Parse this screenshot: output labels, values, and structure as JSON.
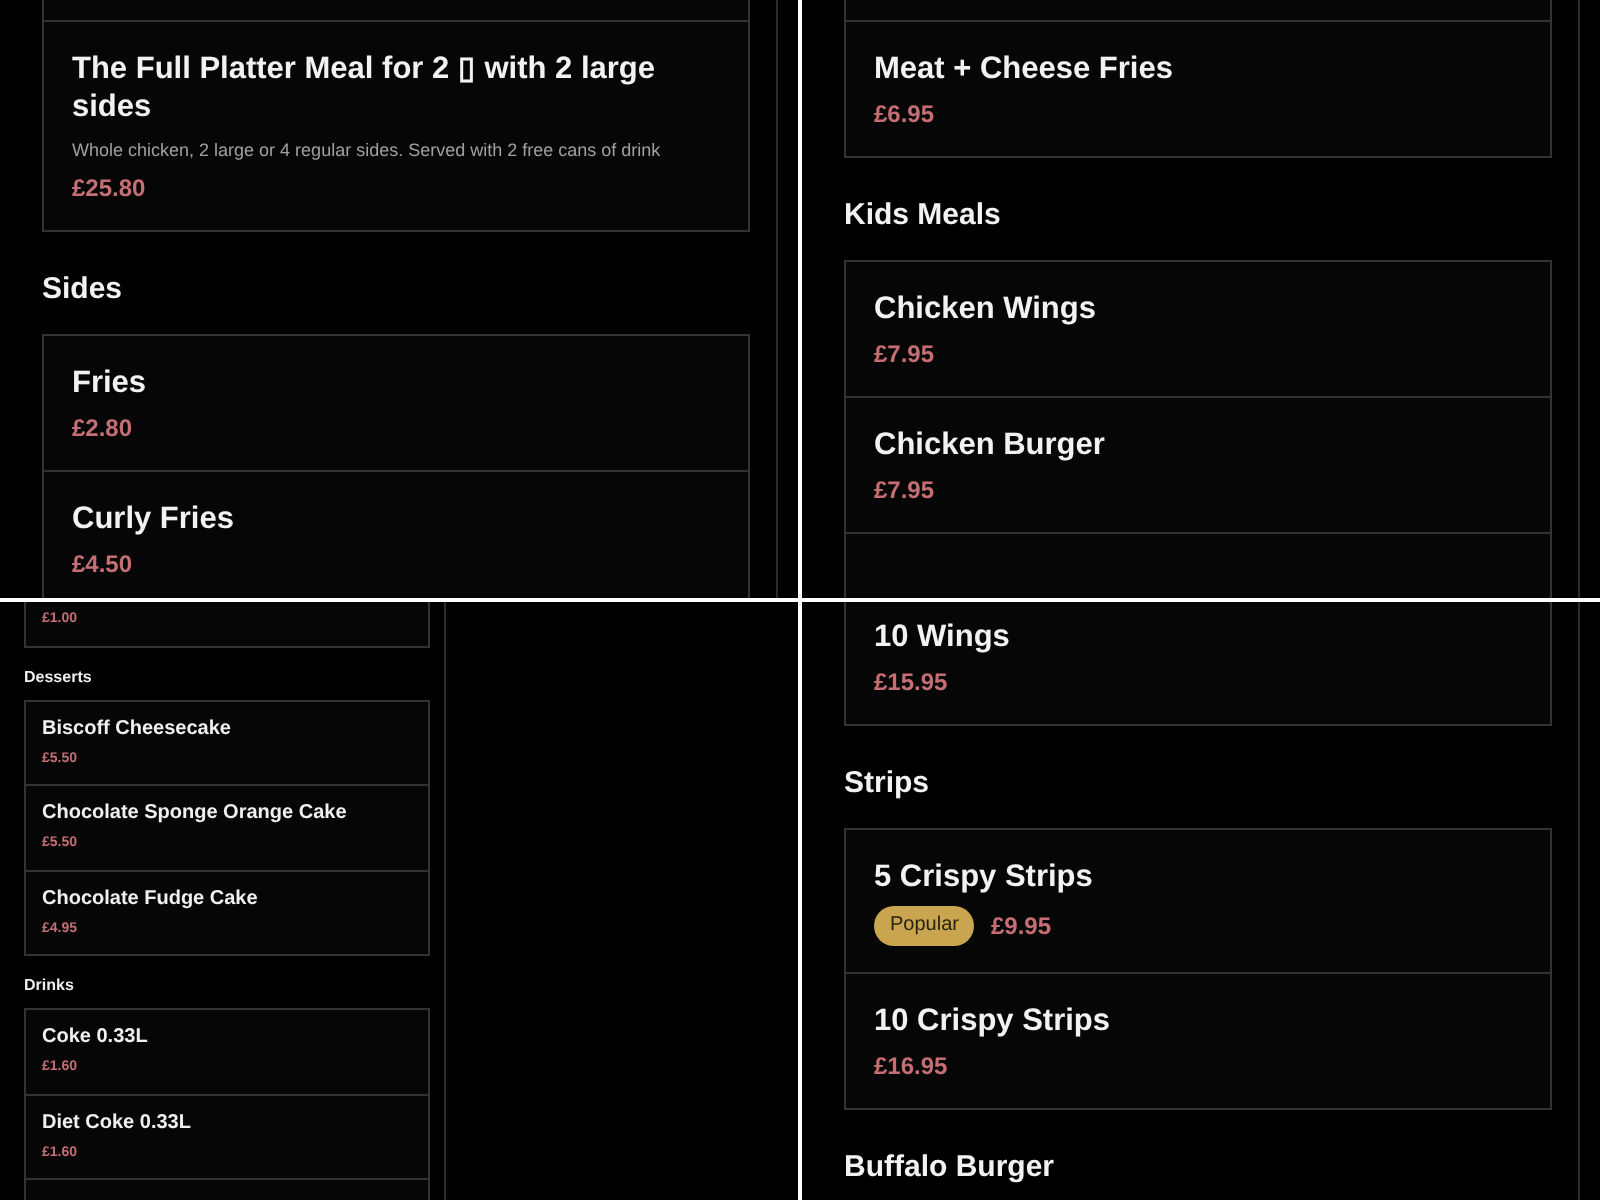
{
  "panels": [
    {
      "kind": "mobile",
      "sections": [
        {
          "continues_from_above": true,
          "items": [
            {
              "name": "The Full Platter Meal for 2 ▯ with 2 large sides",
              "description": "Whole chicken, 2 large or 4 regular sides. Served with 2 free cans of drink",
              "price": "£25.80"
            }
          ]
        },
        {
          "heading": "Sides",
          "items": [
            {
              "name": "Fries",
              "price": "£2.80"
            },
            {
              "name": "Curly Fries",
              "price": "£4.50"
            }
          ]
        }
      ]
    },
    {
      "kind": "mobile",
      "sections": [
        {
          "continues_from_above": true,
          "items": [
            {
              "name": "Meat + Cheese Fries",
              "price": "£6.95"
            }
          ]
        },
        {
          "heading": "Kids Meals",
          "continues_below": true,
          "items": [
            {
              "name": "Chicken Wings",
              "price": "£7.95"
            },
            {
              "name": "Chicken Burger",
              "price": "£7.95"
            }
          ]
        }
      ]
    },
    {
      "kind": "desktop",
      "sections": [
        {
          "items": [
            {
              "price": "£1.00"
            }
          ]
        },
        {
          "heading": "Desserts",
          "items": [
            {
              "name": "Biscoff Cheesecake",
              "price": "£5.50"
            },
            {
              "name": "Chocolate Sponge Orange Cake",
              "price": "£5.50"
            },
            {
              "name": "Chocolate Fudge Cake",
              "price": "£4.95"
            }
          ]
        },
        {
          "heading": "Drinks",
          "continues_below": true,
          "items": [
            {
              "name": "Coke 0.33L",
              "price": "£1.60"
            },
            {
              "name": "Diet Coke 0.33L",
              "price": "£1.60"
            }
          ]
        }
      ]
    },
    {
      "kind": "mobile",
      "sections": [
        {
          "continues_from_above": true,
          "items": [
            {
              "name": "10 Wings",
              "price": "£15.95"
            }
          ]
        },
        {
          "heading": "Strips",
          "items": [
            {
              "name": "5 Crispy Strips",
              "badge": "Popular",
              "price": "£9.95"
            },
            {
              "name": "10 Crispy Strips",
              "price": "£16.95"
            }
          ]
        },
        {
          "heading": "Buffalo Burger"
        }
      ]
    }
  ]
}
